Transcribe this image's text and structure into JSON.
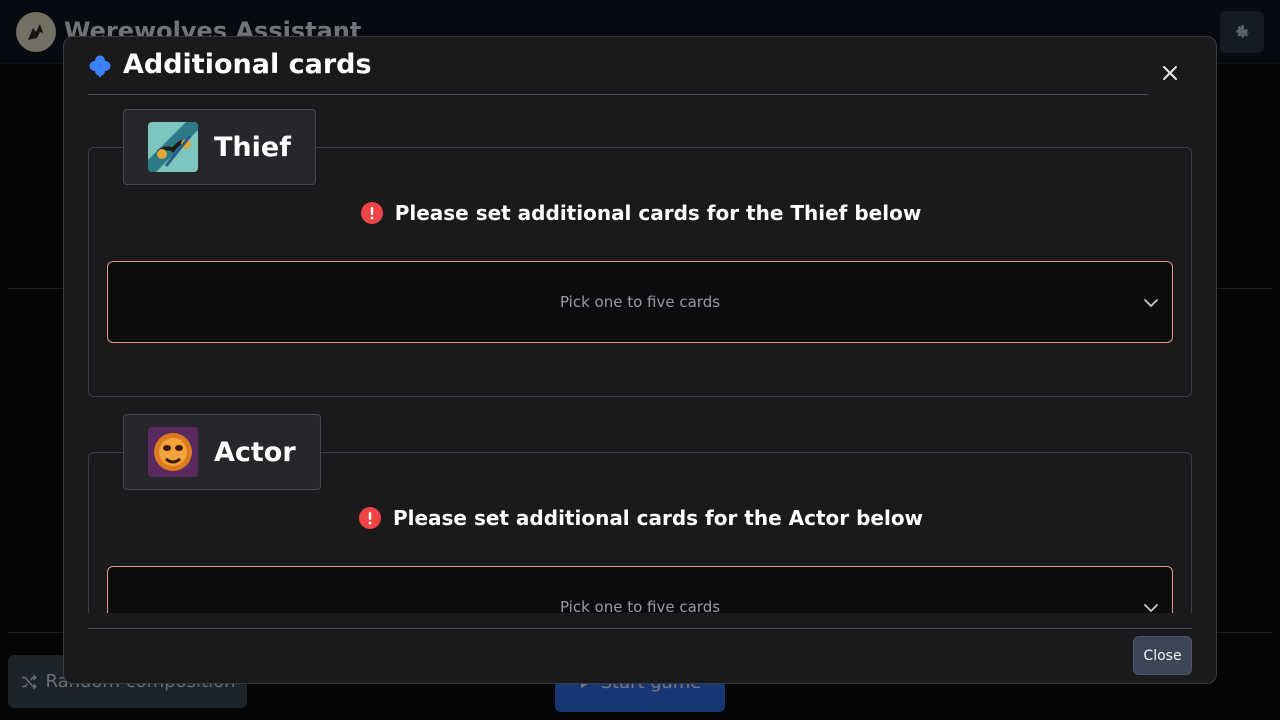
{
  "app": {
    "title": "Werewolves Assistant",
    "random_label": "Random composition",
    "start_label": "Start game"
  },
  "modal": {
    "title": "Additional cards",
    "close_label": "Close"
  },
  "roles": [
    {
      "name": "Thief",
      "warning": "Please set additional cards for the Thief below",
      "placeholder": "Pick one to five cards"
    },
    {
      "name": "Actor",
      "warning": "Please set additional cards for the Actor below",
      "placeholder": "Pick one to five cards"
    }
  ],
  "icons": {
    "clover": "clover-icon",
    "close": "close-icon",
    "warning": "exclamation-circle-icon",
    "chevron": "chevron-down-icon",
    "settings": "gear-icon",
    "shuffle": "shuffle-icon",
    "play": "play-icon"
  },
  "colors": {
    "accent": "#2f6fe8",
    "clover": "#3b82f6",
    "warning": "#ef4444",
    "select_border": "#e7958d"
  }
}
